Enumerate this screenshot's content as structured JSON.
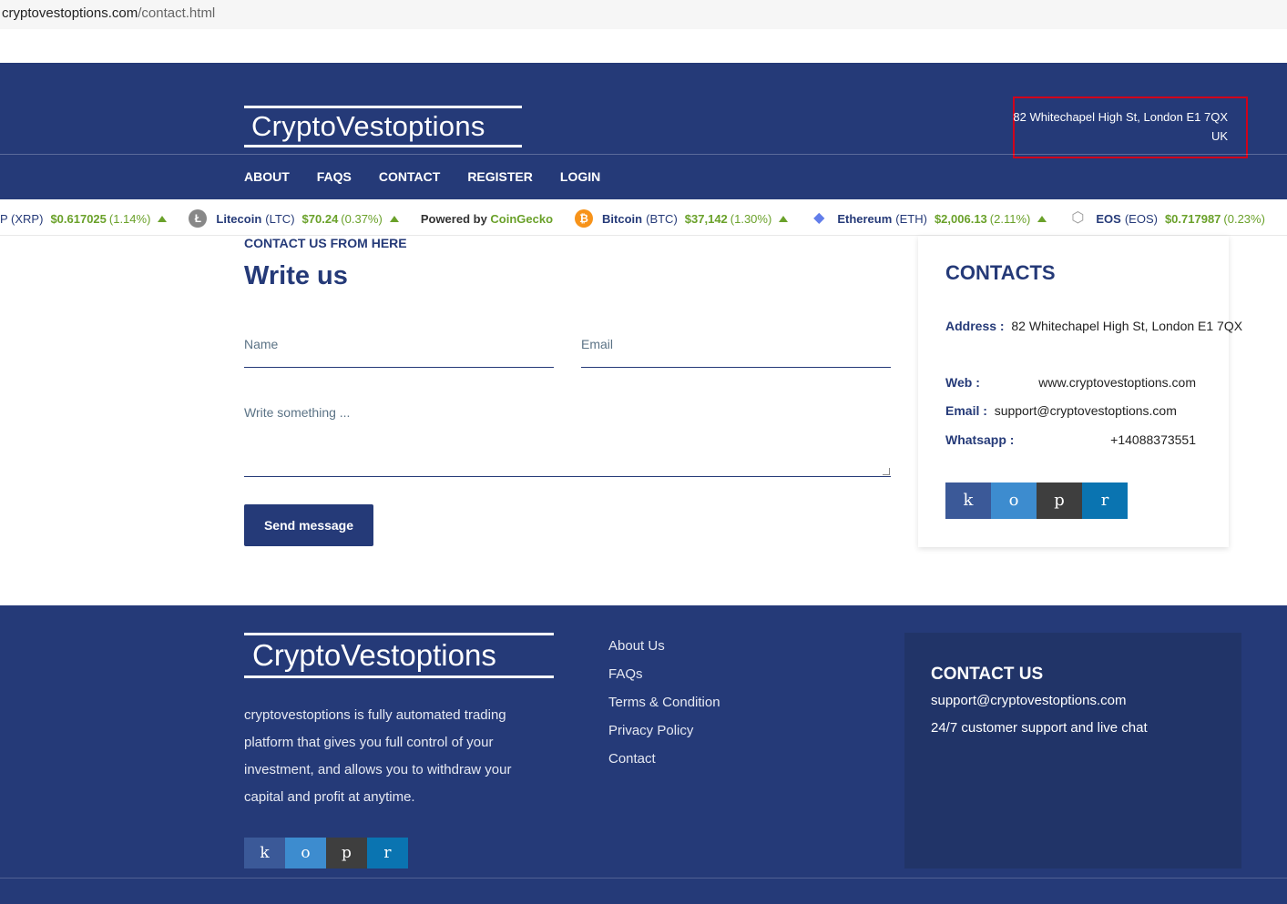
{
  "browser": {
    "url_domain": "cryptovestoptions.com",
    "url_path": "/contact.html"
  },
  "header": {
    "logo": "CryptoVestoptions",
    "address_line1": "82 Whitechapel High St, London E1 7QX",
    "address_line2": "UK",
    "nav": [
      "ABOUT",
      "FAQS",
      "CONTACT",
      "REGISTER",
      "LOGIN"
    ]
  },
  "ticker": {
    "items": [
      {
        "name": "",
        "symbol": "P (XRP)",
        "price": "$0.617025",
        "change": "(1.14%)",
        "icon": "",
        "color": ""
      },
      {
        "name": "Litecoin",
        "symbol": "(LTC)",
        "price": "$70.24",
        "change": "(0.37%)",
        "icon": "litecoin-icon",
        "color": "#888888"
      },
      {
        "name": "Bitcoin",
        "symbol": "(BTC)",
        "price": "$37,142",
        "change": "(1.30%)",
        "icon": "bitcoin-icon",
        "color": "#f7931a"
      },
      {
        "name": "Ethereum",
        "symbol": "(ETH)",
        "price": "$2,006.13",
        "change": "(2.11%)",
        "icon": "ethereum-icon",
        "color": "#627eea"
      },
      {
        "name": "EOS",
        "symbol": "(EOS)",
        "price": "$0.717987",
        "change": "(0.23%)",
        "icon": "eos-icon",
        "color": "#999999"
      }
    ],
    "powered_by": "Powered by",
    "powered_brand": "CoinGecko"
  },
  "contact_form": {
    "subtitle": "CONTACT US FROM HERE",
    "title": "Write us",
    "name_placeholder": "Name",
    "email_placeholder": "Email",
    "message_placeholder": "Write something ...",
    "send_label": "Send message"
  },
  "contacts_card": {
    "title": "CONTACTS",
    "address_label": "Address :",
    "address_value": "82 Whitechapel High St, London E1 7QX",
    "web_label": "Web :",
    "web_value": "www.cryptovestoptions.com",
    "email_label": "Email :",
    "email_value": "support@cryptovestoptions.com",
    "whatsapp_label": "Whatsapp :",
    "whatsapp_value": "+14088373551",
    "social": [
      "k",
      "o",
      "p",
      "r"
    ]
  },
  "footer": {
    "logo": "CryptoVestoptions",
    "description": "cryptovestoptions is fully automated trading platform that gives you full control of your investment, and allows you to withdraw your capital and profit at anytime.",
    "social": [
      "k",
      "o",
      "p",
      "r"
    ],
    "links": [
      "About Us",
      "FAQs",
      "Terms & Condition",
      "Privacy Policy",
      "Contact"
    ],
    "contact_title": "CONTACT US",
    "contact_email": "support@cryptovestoptions.com",
    "contact_support": "24/7 customer support and live chat"
  }
}
